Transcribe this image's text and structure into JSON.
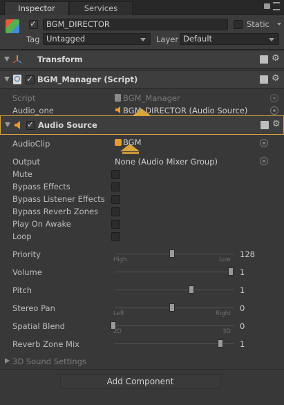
{
  "tabs": [
    {
      "label": "Inspector"
    },
    {
      "label": "Services"
    }
  ],
  "header": {
    "object_name": "BGM_DIRECTOR",
    "static_label": "Static",
    "tag_label": "Tag",
    "tag_value": "Untagged",
    "layer_label": "Layer",
    "layer_value": "Default"
  },
  "transform": {
    "title": "Transform"
  },
  "bgm_manager": {
    "title": "BGM_Manager (Script)",
    "script_label": "Script",
    "script_value": "BGM_Manager",
    "audio_one_label": "Audio_one",
    "audio_one_value": "BGM_DIRECTOR (Audio Source)"
  },
  "audio_source": {
    "title": "Audio Source",
    "audioclip_label": "AudioClip",
    "audioclip_value": "BGM",
    "output_label": "Output",
    "output_value": "None (Audio Mixer Group)",
    "checkboxes": [
      {
        "label": "Mute",
        "checked": false
      },
      {
        "label": "Bypass Effects",
        "checked": false
      },
      {
        "label": "Bypass Listener Effects",
        "checked": false
      },
      {
        "label": "Bypass Reverb Zones",
        "checked": false
      },
      {
        "label": "Play On Awake",
        "checked": false
      },
      {
        "label": "Loop",
        "checked": false
      }
    ],
    "priority": {
      "label": "Priority",
      "value": "128",
      "min_label": "High",
      "max_label": "Low",
      "level": 0.5
    },
    "volume": {
      "label": "Volume",
      "value": "1",
      "level": 1.0
    },
    "pitch": {
      "label": "Pitch",
      "value": "1",
      "level": 0.67
    },
    "stereo_pan": {
      "label": "Stereo Pan",
      "value": "0",
      "min_label": "Left",
      "max_label": "Right",
      "level": 0.5
    },
    "spatial_blend": {
      "label": "Spatial Blend",
      "value": "0",
      "min_label": "2D",
      "max_label": "3D",
      "level": 0.0
    },
    "reverb_zone_mix": {
      "label": "Reverb Zone Mix",
      "value": "1",
      "level": 0.9
    },
    "sound_settings_label": "3D Sound Settings"
  },
  "add_component_label": "Add Component",
  "colors": {
    "highlight": "#d9a43a",
    "background": "#383838"
  }
}
